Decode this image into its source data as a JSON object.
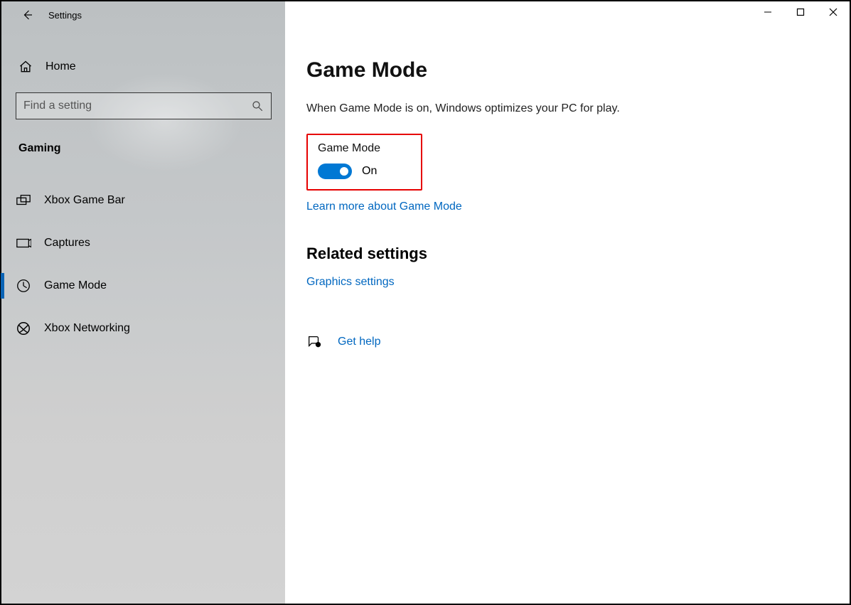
{
  "window": {
    "title": "Settings"
  },
  "sidebar": {
    "home_label": "Home",
    "search_placeholder": "Find a setting",
    "category": "Gaming",
    "items": [
      {
        "label": "Xbox Game Bar",
        "active": false
      },
      {
        "label": "Captures",
        "active": false
      },
      {
        "label": "Game Mode",
        "active": true
      },
      {
        "label": "Xbox Networking",
        "active": false
      }
    ]
  },
  "main": {
    "title": "Game Mode",
    "description": "When Game Mode is on, Windows optimizes your PC for play.",
    "toggle": {
      "caption": "Game Mode",
      "state_label": "On",
      "on": true
    },
    "learn_more": "Learn more about Game Mode",
    "related_heading": "Related settings",
    "graphics_link": "Graphics settings",
    "get_help": "Get help"
  }
}
